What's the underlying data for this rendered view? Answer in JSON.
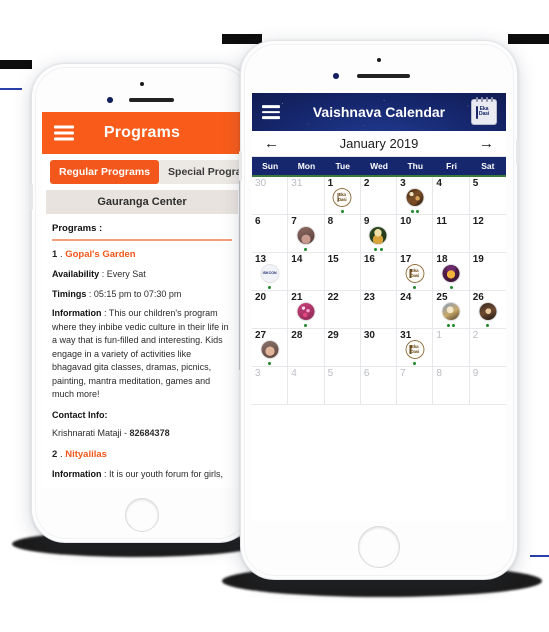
{
  "left_phone": {
    "appbar": {
      "title": "Programs",
      "menu_icon": "hamburger-menu-icon"
    },
    "tabs": [
      {
        "label": "Regular Programs",
        "active": true
      },
      {
        "label": "Special Programs",
        "active": false
      }
    ],
    "center_name": "Gauranga Center",
    "section_heading": "Programs :",
    "items": [
      {
        "number": "1",
        "sep": ".",
        "name": "Gopal's Garden",
        "availability_label": "Availability",
        "availability_value": ": Every Sat",
        "timings_label": "Timings",
        "timings_value": ": 05:15 pm to 07:30 pm",
        "information_label": "Information",
        "information_value": ": This our children's program where they inbibe vedic culture in their life in a way that is fun-filled and interesting. Kids engage in a variety of activities like bhagavad gita classes, dramas, picnics, painting, mantra meditation, games and much more!",
        "contact_heading": "Contact Info:",
        "contact_name": "Krishnarati Mataji - ",
        "contact_phone": "82684378"
      },
      {
        "number": "2",
        "sep": ".",
        "name": "Nityalilas",
        "information_label": "Information",
        "information_value": ": It is our youth forum for girls,"
      }
    ]
  },
  "right_phone": {
    "appbar": {
      "title": "Vaishnava Calendar",
      "menu_icon": "hamburger-menu-icon",
      "badge_icon": "ekadasi-calendar-icon",
      "badge_line1": "Eka",
      "badge_line2": "Dasi"
    },
    "month": {
      "label": "January 2019",
      "prev_icon": "arrow-left-icon",
      "next_icon": "arrow-right-icon"
    },
    "weekdays": [
      "Sun",
      "Mon",
      "Tue",
      "Wed",
      "Thu",
      "Fri",
      "Sat"
    ],
    "colors": {
      "header_navy": "#16276e",
      "accent_orange": "#f4571b",
      "event_dot_green": "#1f8a2a",
      "weekday_underline_green": "#3b7a3b"
    },
    "cells": [
      {
        "d": "30",
        "out": true
      },
      {
        "d": "31",
        "out": true
      },
      {
        "d": "1",
        "icon": "ekadasi",
        "dots": 1
      },
      {
        "d": "2"
      },
      {
        "d": "3",
        "icon": "sw-a",
        "dots": 2
      },
      {
        "d": "4"
      },
      {
        "d": "5"
      },
      {
        "d": "6"
      },
      {
        "d": "7",
        "icon": "sw-b",
        "dots": 1
      },
      {
        "d": "8"
      },
      {
        "d": "9",
        "icon": "sw-c",
        "dots": 2
      },
      {
        "d": "10"
      },
      {
        "d": "11"
      },
      {
        "d": "12"
      },
      {
        "d": "13",
        "icon": "sw-d",
        "dots": 1
      },
      {
        "d": "14"
      },
      {
        "d": "15"
      },
      {
        "d": "16"
      },
      {
        "d": "17",
        "icon": "ekadasi",
        "dots": 1
      },
      {
        "d": "18",
        "icon": "sw-e",
        "dots": 1
      },
      {
        "d": "19"
      },
      {
        "d": "20"
      },
      {
        "d": "21",
        "icon": "sw-f",
        "dots": 1
      },
      {
        "d": "22"
      },
      {
        "d": "23"
      },
      {
        "d": "24"
      },
      {
        "d": "25",
        "icon": "sw-g",
        "dots": 2
      },
      {
        "d": "26",
        "icon": "sw-h",
        "dots": 1
      },
      {
        "d": "27",
        "icon": "sw-i",
        "dots": 1
      },
      {
        "d": "28"
      },
      {
        "d": "29"
      },
      {
        "d": "30"
      },
      {
        "d": "31",
        "icon": "ekadasi",
        "dots": 1
      },
      {
        "d": "1",
        "out": true
      },
      {
        "d": "2",
        "out": true
      },
      {
        "d": "3",
        "out": true
      },
      {
        "d": "4",
        "out": true
      },
      {
        "d": "5",
        "out": true
      },
      {
        "d": "6",
        "out": true
      },
      {
        "d": "7",
        "out": true
      },
      {
        "d": "8",
        "out": true
      },
      {
        "d": "9",
        "out": true
      }
    ],
    "icon_badge_text": {
      "line1": "Eka",
      "line2": "Dasi"
    },
    "iskcon_badge_text": "ISKCON"
  }
}
